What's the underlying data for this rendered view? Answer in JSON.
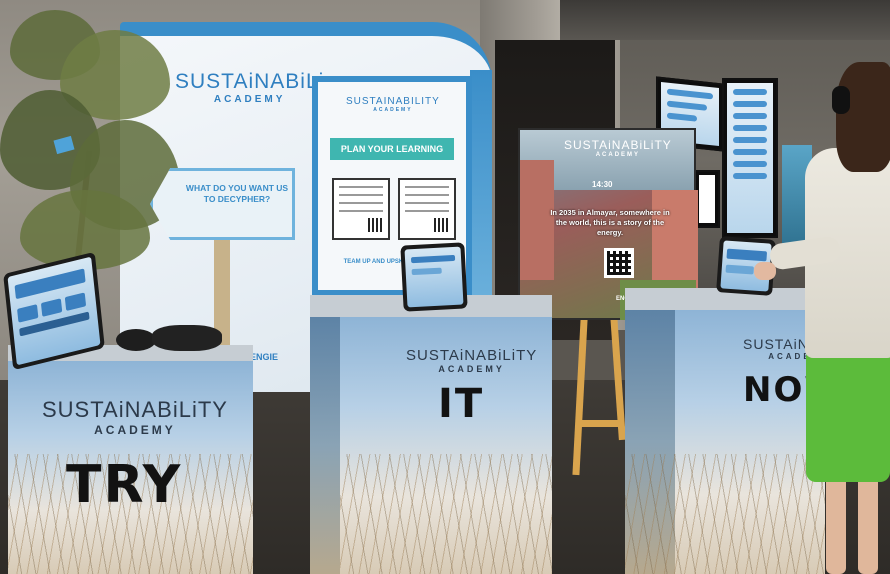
{
  "banner": {
    "logo_main": "SUSTAiNABiLi",
    "logo_sub": "ACADEMY",
    "brand": "ENGIE"
  },
  "sign": {
    "text": "WHAT DO YOU WANT US TO DECYPHER?"
  },
  "poster": {
    "logo_main": "SUSTAINABILITY",
    "logo_sub": "ACADEMY",
    "plan_label": "PLAN YOUR LEARNING",
    "footer": "TEAM UP AND UPSKILL TO ENGIE"
  },
  "game_board": {
    "logo_main": "SUSTAiNABiLiTY",
    "logo_sub": "ACADEMY",
    "time": "14:30",
    "text": "In 2035 in Almayar, somewhere in the world, this is a story of the energy.",
    "footer": "ENGIE"
  },
  "pedestals": [
    {
      "logo_main": "SUSTAiNABiLiTY",
      "logo_sub": "ACADEMY",
      "word": "TRY"
    },
    {
      "logo_main": "SUSTAiNABiLiTY",
      "logo_sub": "ACADEMY",
      "word": "IT"
    },
    {
      "logo_main": "SUSTAiNABiLi",
      "logo_sub": "ACADEM",
      "word": "NOW"
    }
  ],
  "colors": {
    "brand_blue": "#3a8ec9",
    "teal": "#3fb6b0",
    "skirt_green": "#5cbb3b"
  }
}
